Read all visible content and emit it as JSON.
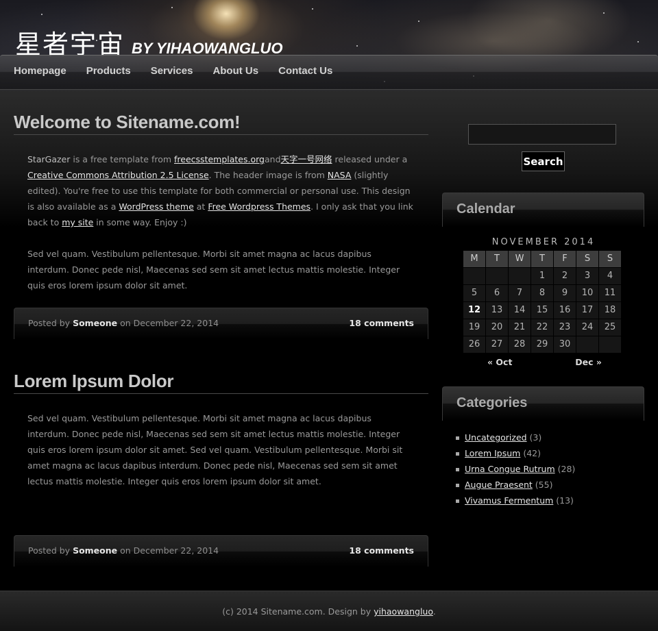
{
  "header": {
    "title_cn": "星者宇宙",
    "title_by": "BY YIHAOWANGLUO"
  },
  "nav": {
    "items": [
      {
        "label": "Homepage"
      },
      {
        "label": "Products"
      },
      {
        "label": "Services"
      },
      {
        "label": "About Us"
      },
      {
        "label": "Contact Us"
      }
    ]
  },
  "posts": [
    {
      "title": "Welcome to Sitename.com!",
      "p1": {
        "t1": "StarGazer",
        "t2": " is a free template from ",
        "link1": "freecsstemplates.org",
        "t3": "and",
        "link2": "天字一号网络",
        "t4": " released under a ",
        "link3": "Creative Commons Attribution 2.5 License",
        "t5": ". The header image is from ",
        "link4": "NASA",
        "t6": " (slightly edited). You're free to use this template for both commercial or personal use. This design is also available as a ",
        "link5": "WordPress theme",
        "t7": " at ",
        "link6": "Free Wordpress Themes",
        "t8": ". I only ask that you link back to ",
        "link7": "my site",
        "t9": " in some way. Enjoy :)"
      },
      "p2": "Sed vel quam. Vestibulum pellentesque. Morbi sit amet magna ac lacus dapibus interdum. Donec pede nisl, Maecenas sed sem sit amet lectus mattis molestie. Integer quis eros lorem ipsum dolor sit amet.",
      "meta": {
        "posted_by": "Posted by ",
        "author": "Someone",
        "on": " on December 22, 2014",
        "comments": "18 comments"
      }
    },
    {
      "title": "Lorem Ipsum Dolor",
      "p1": "Sed vel quam. Vestibulum pellentesque. Morbi sit amet magna ac lacus dapibus interdum. Donec pede nisl, Maecenas sed sem sit amet lectus mattis molestie. Integer quis eros lorem ipsum dolor sit amet. Sed vel quam. Vestibulum pellentesque. Morbi sit amet magna ac lacus dapibus interdum. Donec pede nisl, Maecenas sed sem sit amet lectus mattis molestie. Integer quis eros lorem ipsum dolor sit amet.",
      "meta": {
        "posted_by": "Posted by ",
        "author": "Someone",
        "on": " on December 22, 2014",
        "comments": "18 comments"
      }
    }
  ],
  "search": {
    "value": "",
    "button": "Search"
  },
  "calendar": {
    "title": "Calendar",
    "caption": "NOVEMBER 2014",
    "weekdays": [
      "M",
      "T",
      "W",
      "T",
      "F",
      "S",
      "S"
    ],
    "days": [
      "",
      "",
      "",
      "1",
      "2",
      "3",
      "4",
      "5",
      "6",
      "7",
      "8",
      "9",
      "10",
      "11",
      "12",
      "13",
      "14",
      "15",
      "16",
      "17",
      "18",
      "19",
      "20",
      "21",
      "22",
      "23",
      "24",
      "25",
      "26",
      "27",
      "28",
      "29",
      "30",
      "",
      ""
    ],
    "today": "12",
    "prev": "« Oct",
    "next": "Dec »"
  },
  "categories": {
    "title": "Categories",
    "items": [
      {
        "label": "Uncategorized",
        "count": " (3)"
      },
      {
        "label": "Lorem Ipsum",
        "count": " (42)"
      },
      {
        "label": "Urna Congue Rutrum",
        "count": " (28)"
      },
      {
        "label": "Augue Praesent",
        "count": " (55)"
      },
      {
        "label": "Vivamus Fermentum",
        "count": " (13)"
      }
    ]
  },
  "footer": {
    "t1": "(c) 2014 Sitename.com. Design by ",
    "link": "yihaowangluo",
    "t2": "."
  },
  "colors": {
    "background": "#000000",
    "link": "#e6e6e6",
    "text": "#9a9a9a",
    "heading": "#c9c9c9"
  }
}
